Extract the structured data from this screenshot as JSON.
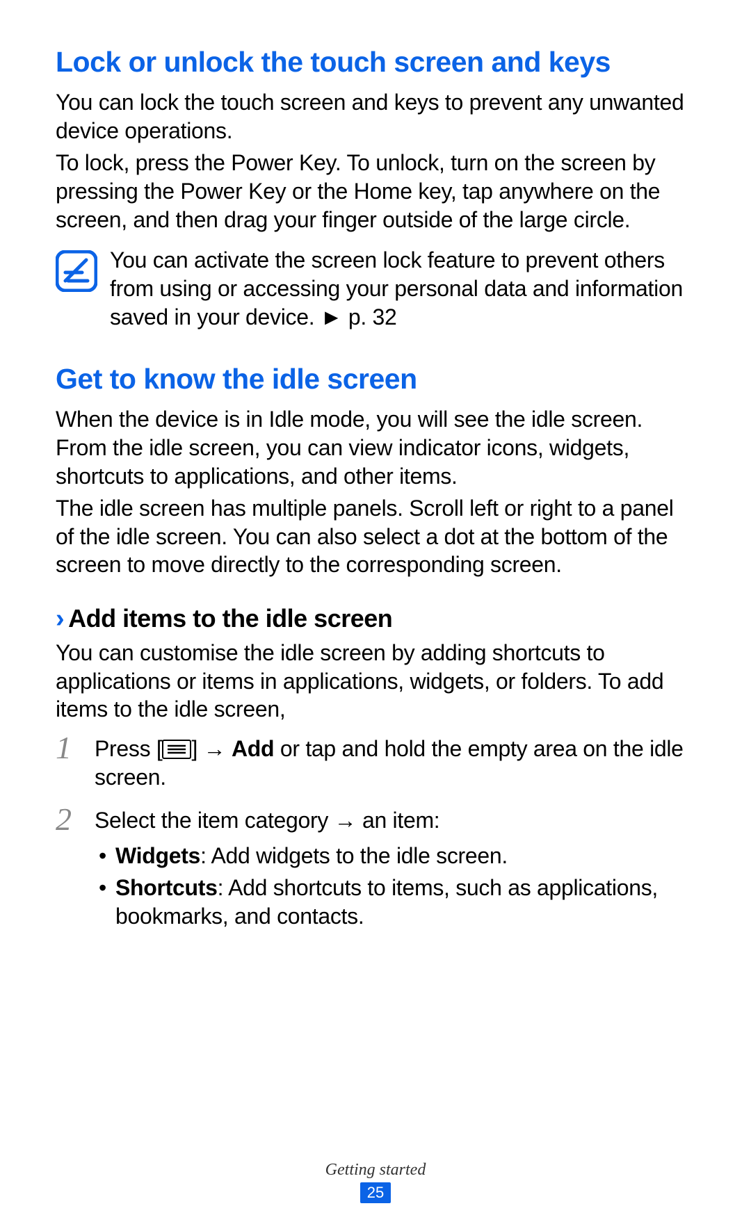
{
  "section1": {
    "heading": "Lock or unlock the touch screen and keys",
    "para1": "You can lock the touch screen and keys to prevent any unwanted device operations.",
    "para2": "To lock, press the Power Key. To unlock, turn on the screen by pressing the Power Key or the Home key, tap anywhere on the screen, and then drag your finger outside of the large circle.",
    "note": "You can activate the screen lock feature to prevent others from using or accessing your personal data and information saved in your device. ► p. 32"
  },
  "section2": {
    "heading": "Get to know the idle screen",
    "para1": "When the device is in Idle mode, you will see the idle screen. From the idle screen, you can view indicator icons, widgets, shortcuts to applications, and other items.",
    "para2": "The idle screen has multiple panels. Scroll left or right to a panel of the idle screen. You can also select a dot at the bottom of the screen to move directly to the corresponding screen.",
    "sub": {
      "heading": "Add items to the idle screen",
      "intro": "You can customise the idle screen by adding shortcuts to applications or items in applications, widgets, or folders. To add items to the idle screen,",
      "step1_pre": "Press [",
      "step1_mid": "] → ",
      "step1_bold": "Add",
      "step1_post": " or tap and hold the empty area on the idle screen.",
      "step2_pre": "Select the item category → an item:",
      "bullet1_bold": "Widgets",
      "bullet1_rest": ": Add widgets to the idle screen.",
      "bullet2_bold": "Shortcuts",
      "bullet2_rest": ": Add shortcuts to items, such as applications, bookmarks, and contacts."
    }
  },
  "footer": {
    "section": "Getting started",
    "page": "25"
  }
}
